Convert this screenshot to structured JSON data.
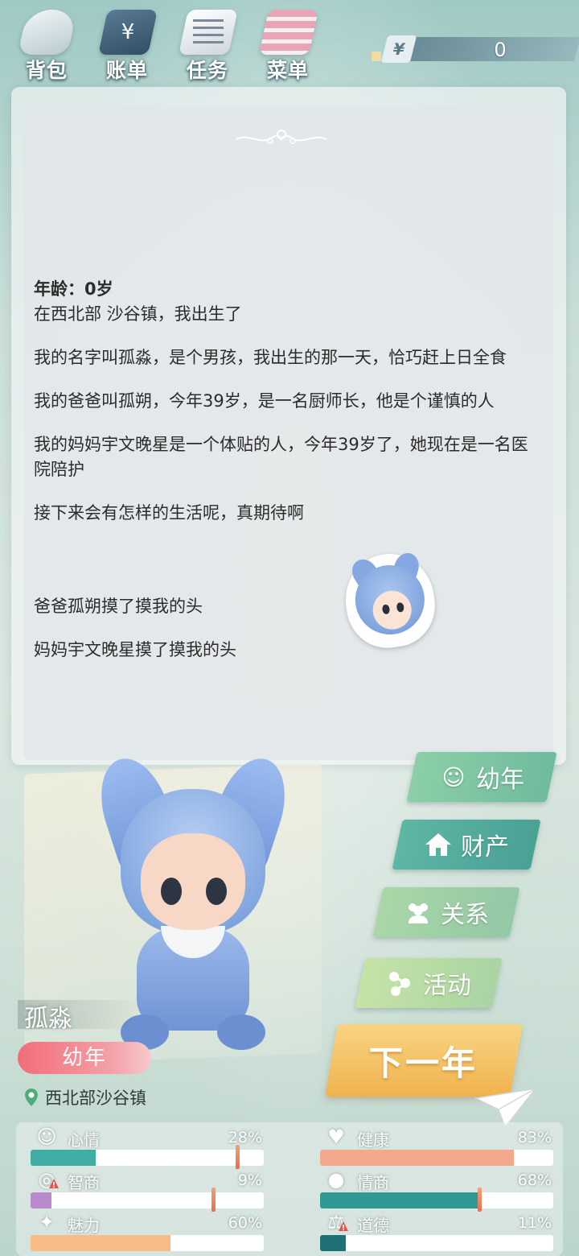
{
  "topbar": {
    "items": [
      {
        "label": "背包",
        "icon": "bag-icon"
      },
      {
        "label": "账单",
        "icon": "bill-icon",
        "glyph": "¥"
      },
      {
        "label": "任务",
        "icon": "task-list-icon"
      },
      {
        "label": "菜单",
        "icon": "menu-icon"
      }
    ],
    "currency_symbol": "¥",
    "money": "0"
  },
  "story": {
    "age_line": "年龄：0岁",
    "paragraphs": [
      "在西北部 沙谷镇，我出生了",
      "我的名字叫孤淼，是个男孩，我出生的那一天，恰巧赶上日全食",
      "我的爸爸叫孤朔，今年39岁，是一名厨师长，他是个谨慎的人",
      "我的妈妈宇文晚星是一个体贴的人，今年39岁了，她现在是一名医院陪护",
      "接下来会有怎样的生活呢，真期待啊",
      "爸爸孤朔摸了摸我的头",
      "妈妈宇文晚星摸了摸我的头"
    ]
  },
  "character": {
    "name": "孤淼",
    "stage": "幼年",
    "location": "西北部沙谷镇"
  },
  "side_buttons": {
    "stage": "幼年",
    "assets": "财产",
    "relations": "关系",
    "activities": "活动",
    "next_year": "下一年"
  },
  "stats": [
    {
      "key": "mood",
      "label": "心情",
      "value": "28%",
      "level": 0.28,
      "icon": "smiley-face-icon",
      "color": "#42ada3",
      "warning": false
    },
    {
      "key": "health",
      "label": "健康",
      "value": "83%",
      "level": 0.83,
      "icon": "heart-icon",
      "color": "#f4a98c",
      "warning": false
    },
    {
      "key": "iq",
      "label": "智商",
      "value": "9%",
      "level": 0.09,
      "icon": "lightbulb-icon",
      "color": "#b98ac9",
      "warning": true
    },
    {
      "key": "eq",
      "label": "情商",
      "value": "68%",
      "level": 0.68,
      "icon": "apple-icon",
      "color": "#2f9a95",
      "warning": false
    },
    {
      "key": "charm",
      "label": "魅力",
      "value": "60%",
      "level": 0.6,
      "icon": "sparkle-icon",
      "color": "#f7bb86",
      "warning": false
    },
    {
      "key": "morality",
      "label": "道德",
      "value": "11%",
      "level": 0.11,
      "icon": "scales-icon",
      "color": "#1f6f78",
      "warning": true
    }
  ],
  "colors": {
    "accent_next": "#f0b24d",
    "stage_badge": "#f16d7a"
  }
}
